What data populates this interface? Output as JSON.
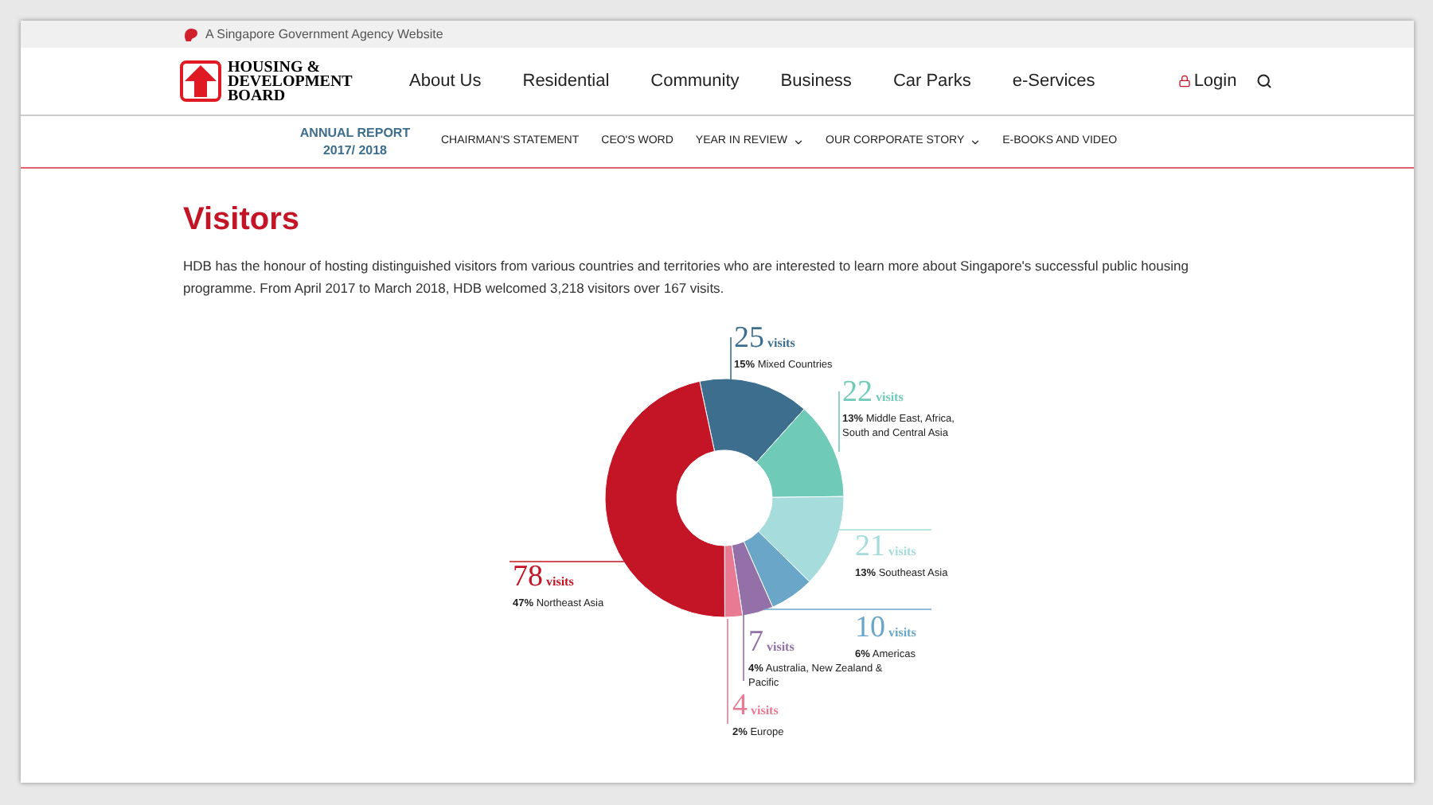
{
  "gov_bar": {
    "text": "A Singapore Government Agency Website"
  },
  "header": {
    "logo_text": "HOUSING & DEVELOPMENT BOARD",
    "nav": [
      "About Us",
      "Residential",
      "Community",
      "Business",
      "Car Parks",
      "e-Services"
    ],
    "login": "Login"
  },
  "subnav": {
    "report_title": "ANNUAL REPORT",
    "report_year": "2017/ 2018",
    "items": [
      {
        "label": "CHAIRMAN'S STATEMENT",
        "dropdown": false
      },
      {
        "label": "CEO'S WORD",
        "dropdown": false
      },
      {
        "label": "YEAR IN REVIEW",
        "dropdown": true
      },
      {
        "label": "OUR CORPORATE STORY",
        "dropdown": true
      },
      {
        "label": "E-BOOKS AND VIDEO",
        "dropdown": false
      }
    ]
  },
  "page": {
    "title": "Visitors",
    "intro": "HDB has the honour of hosting distinguished visitors from various countries and territories who are interested to learn more about Singapore's successful public housing programme. From April 2017 to March 2018, HDB welcomed 3,218 visitors over 167 visits."
  },
  "visitors": {
    "slices": [
      {
        "count": "25",
        "unit": "visits",
        "percent": "15%",
        "color": "#3d6e8e"
      },
      {
        "count": "22",
        "unit": "visits",
        "percent": "13%",
        "color": "#6fcab8"
      },
      {
        "count": "21",
        "unit": "visits",
        "percent": "13%",
        "color": "#a6dcdc"
      },
      {
        "count": "10",
        "unit": "visits",
        "percent": "6%",
        "color": "#6aa6c8"
      },
      {
        "count": "7",
        "unit": "visits",
        "percent": "4%",
        "color": "#9470a8"
      },
      {
        "count": "4",
        "unit": "visits",
        "percent": "2%",
        "color": "#e87a94"
      },
      {
        "count": "78",
        "unit": "visits",
        "percent": "47%",
        "color": "#c41526"
      }
    ],
    "chart_data": {
      "type": "donut",
      "categories": [
        "Mixed Countries",
        "Middle East, Africa, South and Central Asia",
        "Southeast Asia",
        "Americas",
        "Australia, New Zealand & Pacific",
        "Europe",
        "Northeast Asia"
      ],
      "series": [
        {
          "values": [
            25,
            22,
            21,
            10,
            7,
            4,
            78
          ]
        }
      ],
      "data_labels": true
    }
  }
}
